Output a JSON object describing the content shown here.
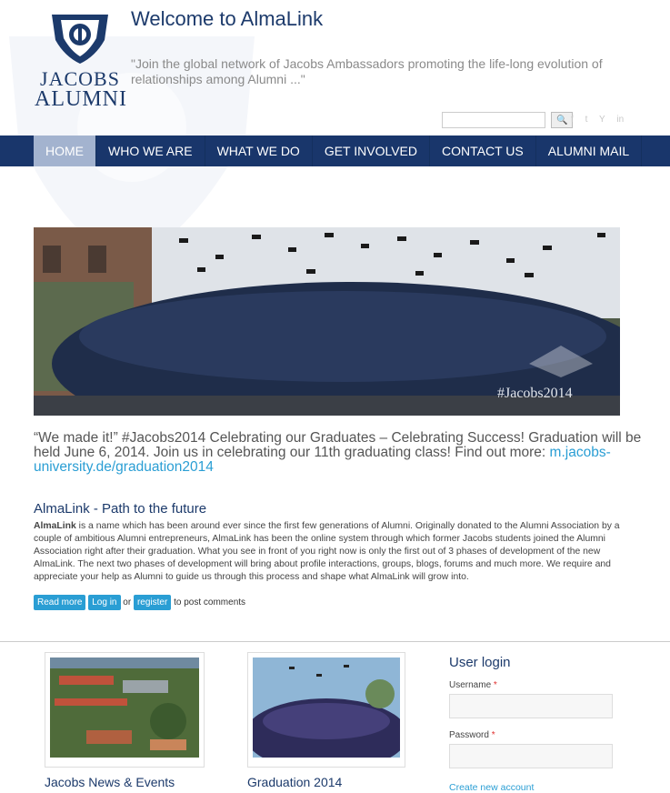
{
  "site": {
    "logo_line1": "JACOBS",
    "logo_line2": "ALUMNI",
    "title": "Welcome to AlmaLink",
    "slogan": "\"Join the global network of Jacobs Ambassadors promoting the life-long evolution of relationships among Alumni ...\""
  },
  "search": {
    "value": "",
    "button": "🔍"
  },
  "social": [
    "f",
    "t",
    "Y",
    "in"
  ],
  "nav": [
    "HOME",
    "WHO WE ARE",
    "WHAT WE DO",
    "GET INVOLVED",
    "CONTACT US",
    "ALUMNI MAIL"
  ],
  "banner": {
    "watermark": "#Jacobs2014"
  },
  "caption": {
    "text": "“We made it!” #Jacobs2014 Celebrating our Graduates – Celebrating Success! Graduation will be held June 6, 2014. Join us in celebrating our 11th graduating class! Find out more: ",
    "link": "m.jacobs-university.de/graduation2014"
  },
  "article": {
    "title": "AlmaLink - Path to the future",
    "lead": "AlmaLink",
    "body": " is a name which has been around ever since the first few generations of Alumni. Originally donated to the Alumni Association by a couple of ambitious Alumni entrepreneurs, AlmaLink has been the online system through which former Jacobs students joined the Alumni Association right after their graduation. What you see in front of you right now is only the first out of 3 phases of development of the new AlmaLink. The next two phases of development will bring about profile interactions, groups, blogs, forums and much more. We require and appreciate your help as Alumni to guide us through this process and shape what AlmaLink will grow into.",
    "read_more": "Read more",
    "login": "Log in",
    "or": "or",
    "register": "register",
    "post_comments": "to post comments"
  },
  "blocks": [
    {
      "title": "Jacobs News & Events"
    },
    {
      "title": "Graduation 2014"
    }
  ],
  "login": {
    "title": "User login",
    "username_label": "Username",
    "password_label": "Password",
    "required": "*",
    "create_account": "Create new account"
  }
}
